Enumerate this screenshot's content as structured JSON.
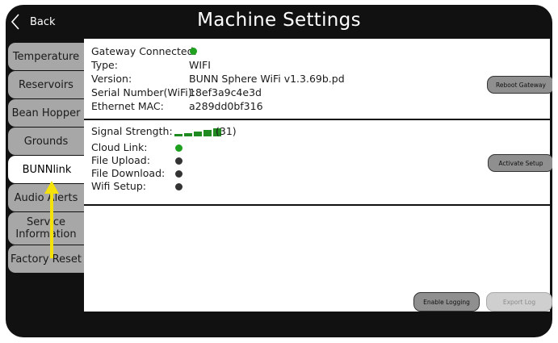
{
  "header": {
    "back_label": "Back",
    "title": "Machine Settings"
  },
  "sidebar": {
    "tabs": [
      {
        "label": "Temperature"
      },
      {
        "label": "Reservoirs"
      },
      {
        "label": "Bean Hopper"
      },
      {
        "label": "Grounds"
      },
      {
        "label": "BUNNlink"
      },
      {
        "label": "Audio Alerts"
      },
      {
        "label": "Service Information"
      },
      {
        "label": "Factory Reset"
      }
    ],
    "active_tab": "BUNNlink"
  },
  "gateway": {
    "connected_label": "Gateway Connected:",
    "connected_status": "on",
    "type_label": "Type:",
    "type_value": "WIFI",
    "version_label": "Version:",
    "version_value": "BUNN Sphere WiFi v1.3.69b.pd",
    "serial_label": "Serial Number(WiFi):",
    "serial_value": "18ef3a9c4e3d",
    "mac_label": "Ethernet MAC:",
    "mac_value": "a289dd0bf316",
    "reboot_button": "Reboot Gateway"
  },
  "link": {
    "signal_label": "Signal Strength:",
    "signal_bars": 5,
    "signal_value": "(31)",
    "cloud_label": "Cloud Link:",
    "cloud_status": "on",
    "upload_label": "File Upload:",
    "upload_status": "off",
    "download_label": "File Download:",
    "download_status": "off",
    "wifi_setup_label": "Wifi Setup:",
    "wifi_setup_status": "off",
    "activate_button": "Activate Setup"
  },
  "footer": {
    "enable_logging_button": "Enable Logging",
    "export_log_button": "Export Log"
  },
  "colors": {
    "status_on": "#1fa01f",
    "status_off": "#333333",
    "signal": "#1f8a1f",
    "annotation_arrow": "#f5e20a"
  },
  "icons": {
    "back": "chevron-left-icon",
    "annotation": "arrow-up-icon"
  }
}
